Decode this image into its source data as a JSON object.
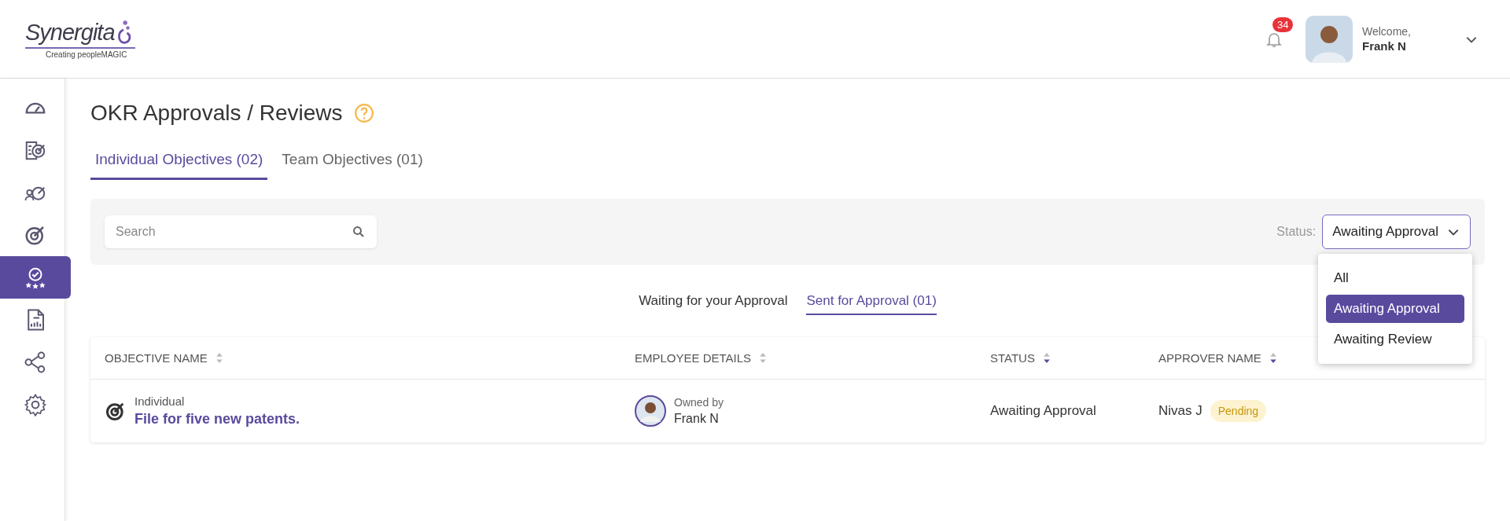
{
  "header": {
    "logo": {
      "name": "Synergita",
      "tagline": "Creating peopleMAGIC"
    },
    "notifications": {
      "count": "34"
    },
    "user": {
      "greeting": "Welcome,",
      "name": "Frank N"
    }
  },
  "sidebar": {
    "items": [
      {
        "selected": false
      },
      {
        "selected": false
      },
      {
        "selected": false
      },
      {
        "selected": false
      },
      {
        "selected": true
      },
      {
        "selected": false
      },
      {
        "selected": false
      },
      {
        "selected": false
      }
    ]
  },
  "page": {
    "title": "OKR Approvals / Reviews"
  },
  "tabs": [
    {
      "label": "Individual Objectives (02)",
      "selected": true
    },
    {
      "label": "Team Objectives (01)",
      "selected": false
    }
  ],
  "filter": {
    "search": {
      "placeholder": "Search"
    },
    "status_label": "Status:",
    "status_value": "Awaiting Approval",
    "options": [
      {
        "label": "All",
        "selected": false
      },
      {
        "label": "Awaiting Approval",
        "selected": true
      },
      {
        "label": "Awaiting Review",
        "selected": false
      }
    ]
  },
  "subtabs": [
    {
      "label": "Waiting for your Approval",
      "selected": false
    },
    {
      "label": "Sent for Approval (01)",
      "selected": true
    }
  ],
  "table": {
    "columns": [
      {
        "label": "OBJECTIVE NAME",
        "sorted": false
      },
      {
        "label": "EMPLOYEE DETAILS",
        "sorted": false
      },
      {
        "label": "STATUS",
        "sorted": true
      },
      {
        "label": "APPROVER NAME",
        "sorted": true
      }
    ],
    "rows": [
      {
        "type": "Individual",
        "objective": "File for five new patents.",
        "owner_label": "Owned by",
        "owner": "Frank N",
        "status": "Awaiting Approval",
        "approver": "Nivas J",
        "badge": "Pending"
      }
    ]
  }
}
